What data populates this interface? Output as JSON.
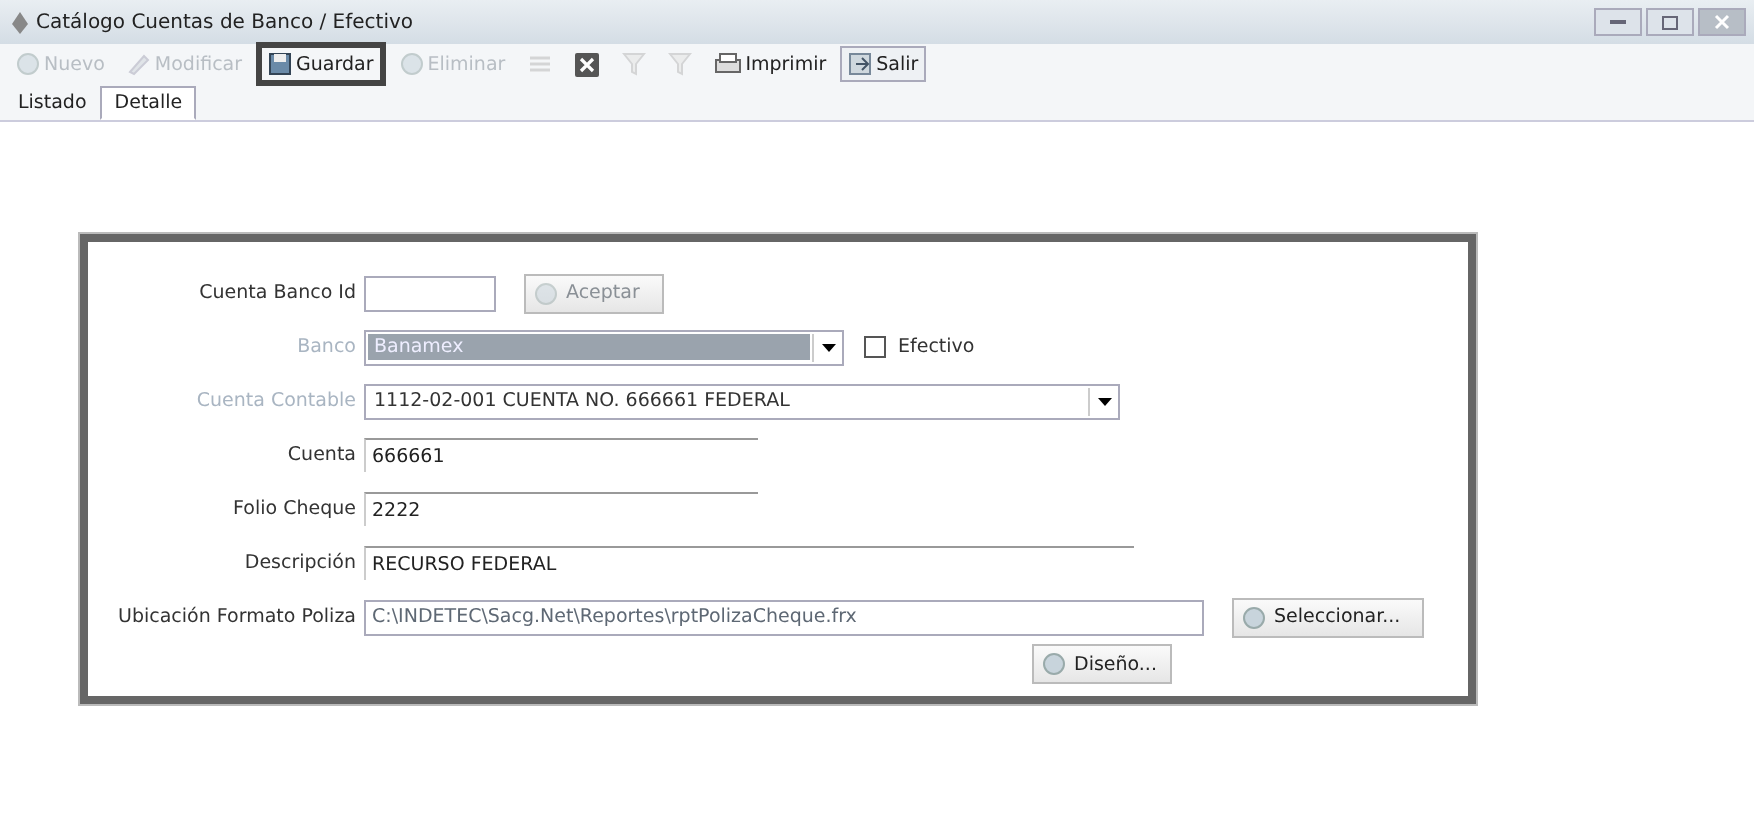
{
  "window": {
    "title": "Catálogo Cuentas de Banco / Efectivo"
  },
  "toolbar": [
    {
      "kind": "button",
      "label": "Nuevo",
      "disabled": true,
      "highlighted": false
    },
    {
      "kind": "button",
      "label": "Modificar",
      "disabled": true,
      "highlighted": false
    },
    {
      "kind": "button",
      "label": "Guardar",
      "disabled": false,
      "highlighted": true
    },
    {
      "kind": "button",
      "label": "Eliminar",
      "disabled": true,
      "highlighted": false
    },
    {
      "kind": "icon",
      "disabled": true,
      "highlighted": false
    },
    {
      "kind": "icon",
      "disabled": false,
      "highlighted": false
    },
    {
      "kind": "icon",
      "disabled": true,
      "highlighted": false
    },
    {
      "kind": "icon",
      "disabled": true,
      "highlighted": false
    },
    {
      "kind": "button",
      "label": "Imprimir",
      "disabled": false,
      "highlighted": false
    },
    {
      "kind": "button",
      "label": "Salir",
      "disabled": false,
      "highlighted": false,
      "framed": true
    }
  ],
  "tabs": [
    {
      "label": "Listado",
      "selected": false
    },
    {
      "label": "Detalle",
      "selected": true
    }
  ],
  "form": {
    "rows": [
      {
        "kind": "id",
        "label": "Cuenta Banco Id",
        "label_disabled": false,
        "value": "",
        "button": {
          "label": "Aceptar",
          "disabled": true
        }
      },
      {
        "kind": "combo",
        "label": "Banco",
        "label_disabled": true,
        "value": "Banamex",
        "highlighted": true,
        "checkbox": {
          "label": "Efectivo",
          "checked": false
        }
      },
      {
        "kind": "combo",
        "label": "Cuenta Contable",
        "label_disabled": true,
        "value": "1112-02-001 CUENTA NO. 666661 FEDERAL",
        "highlighted": false
      },
      {
        "kind": "text",
        "label": "Cuenta",
        "label_disabled": false,
        "value": "666661"
      },
      {
        "kind": "text",
        "label": "Folio Cheque",
        "label_disabled": false,
        "value": "2222"
      },
      {
        "kind": "wide_text",
        "label": "Descripción",
        "label_disabled": false,
        "value": "RECURSO FEDERAL"
      },
      {
        "kind": "path",
        "label": "Ubicación Formato Poliza",
        "label_disabled": false,
        "value": "C:\\INDETEC\\Sacg.Net\\Reportes\\rptPolizaCheque.frx",
        "button": {
          "label": "Seleccionar...",
          "disabled": false
        }
      }
    ],
    "footer_button": {
      "label": "Diseño..."
    }
  }
}
